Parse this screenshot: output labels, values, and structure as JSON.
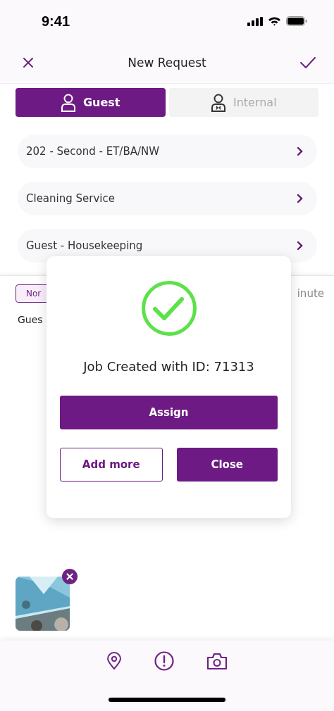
{
  "status_bar": {
    "time": "9:41"
  },
  "header": {
    "title": "New Request"
  },
  "tabs": [
    {
      "label": "Guest",
      "kind": "guest",
      "selected": true
    },
    {
      "label": "Internal",
      "kind": "staff",
      "selected": false
    }
  ],
  "fields": [
    {
      "value": "202 - Second - ET/BA/NW"
    },
    {
      "value": "Cleaning Service"
    },
    {
      "value": "Guest - Housekeeping"
    }
  ],
  "priority_tag": "Nor",
  "duration_fragment": "inute",
  "description_fragment": "Gues",
  "dialog": {
    "message": "Job Created with ID: 71313",
    "primary_button": "Assign",
    "secondary_button": "Add more",
    "close_button": "Close"
  },
  "toolbar": [
    {
      "kind": "location"
    },
    {
      "kind": "alert"
    },
    {
      "kind": "camera"
    }
  ]
}
